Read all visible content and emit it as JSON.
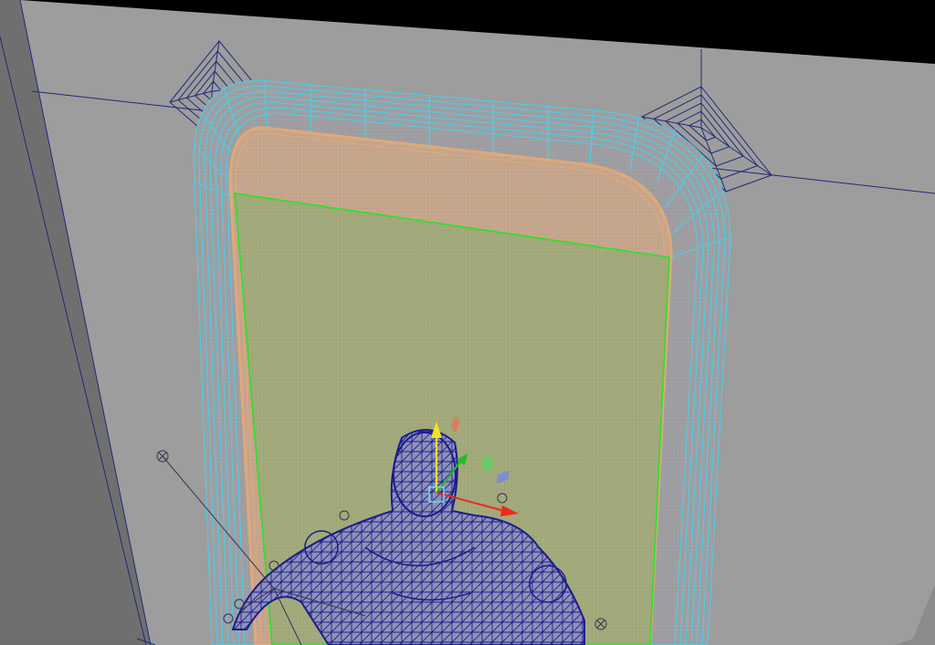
{
  "viewport": {
    "kind": "3d-wireframe-viewport",
    "background": "#000000",
    "colors": {
      "wall_light": "#9d9d9d",
      "wall_mid": "#8b8b8b",
      "wall_dark": "#6f6f6f",
      "floor_edge": "#5e5e5e",
      "wire_dark": "#1f2a78",
      "frame_outline": "#3fd4ee",
      "frame_fill": "#a0a0a4",
      "inner_rim": "#e1a878",
      "inner_fill": "#c7a88e",
      "glass_outline": "#27e427",
      "glass_fill": "#a4ab7c",
      "character_wire": "#1c1c8c",
      "gizmo_y": "#f2e41a",
      "gizmo_x": "#ee2a1a",
      "gizmo_z": "#20c020",
      "gizmo_center": "#6fd0f0",
      "gizmo_plane_blue": "#7a8adc"
    },
    "objects": [
      {
        "name": "wall-plane",
        "icon": "polygon-mesh-icon"
      },
      {
        "name": "door-frame-mesh",
        "icon": "polygon-mesh-icon"
      },
      {
        "name": "door-inner-panel",
        "icon": "polygon-mesh-icon"
      },
      {
        "name": "glass-plane",
        "icon": "polygon-mesh-icon"
      },
      {
        "name": "character-wireframe",
        "icon": "character-mesh-icon"
      },
      {
        "name": "move-manipulator",
        "icon": "move-tool-icon"
      },
      {
        "name": "ik-locator",
        "icon": "locator-icon"
      }
    ]
  }
}
